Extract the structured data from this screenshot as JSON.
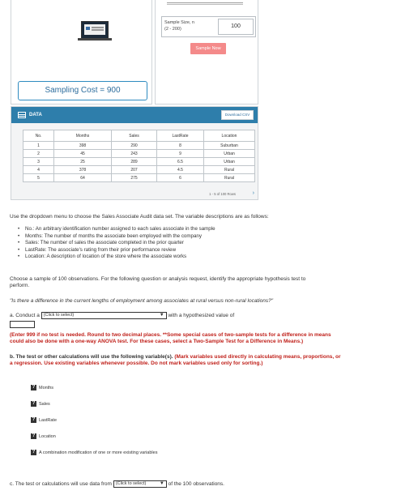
{
  "sampling_cost_label": "Sampling Cost = 900",
  "sample_size": {
    "label_line1": "Sample Size, n",
    "label_line2": "(2 - 200)",
    "value": "100",
    "button_label": "Sample Now"
  },
  "data_panel": {
    "title": "DATA",
    "download_label": "Download CSV",
    "columns": [
      "No.",
      "Months",
      "Sales",
      "LastRate",
      "Location"
    ],
    "rows": [
      [
        "1",
        "398",
        "290",
        "8",
        "Suburban"
      ],
      [
        "2",
        "45",
        "243",
        "9",
        "Urban"
      ],
      [
        "3",
        "25",
        "289",
        "6.5",
        "Urban"
      ],
      [
        "4",
        "378",
        "207",
        "4.5",
        "Rural"
      ],
      [
        "5",
        "64",
        "275",
        "6",
        "Rural"
      ]
    ],
    "pager_text": "1 - 5 of 100 Rows",
    "pager_next": "›"
  },
  "instructions": {
    "intro": "Use the dropdown menu to choose the Sales Associate Audit data set. The variable descriptions are as follows:",
    "variables": [
      "No.: An arbitrary identification number assigned to each sales associate in the sample",
      "Months: The number of months the associate been employed with the company",
      "Sales: The number of sales the associate completed in the prior quarter",
      "LastRate: The associate's rating from their prior performance review",
      "Location: A description of location of the store where the associate works"
    ],
    "choose_line1": "Choose a sample of 100 observations. For the following question or analysis request, identify the appropriate hypothesis test to",
    "choose_line2": "perform.",
    "question": "\"Is there a difference in the current lengths of employment among associates at rural versus non-rural locations?\""
  },
  "part_a": {
    "prefix": "a. Conduct a",
    "select_label": "(Click to select)",
    "suffix": "with a hypothesized value of",
    "note_line1": "(Enter 999 if no test is needed. Round to two decimal places. **Some special cases of two-sample tests for a difference in means",
    "note_line2": "could also be done with a one-way ANOVA test. For these cases, select a Two-Sample Test for a Difference in Means.)"
  },
  "part_b": {
    "text_plain": "b. The test or other calculations will use the following variable(s).",
    "text_red_1": "(Mark variables used directly in calculating means, proportions, or",
    "text_red_2": "a regression. Use existing variables whenever possible. Do not mark variables used only for sorting.)",
    "options": [
      "Months",
      "Sales",
      "LastRate",
      "Location",
      "A combination modification of one or more existing variables"
    ],
    "checkbox_mark": "?"
  },
  "part_c": {
    "prefix": "c. The test or calculations will use data from",
    "select_label": "(Click to select)",
    "suffix": "of the 100 observations."
  },
  "colors": {
    "header_blue": "#2e7eab",
    "sample_button": "#f48a8a",
    "note_red": "#c0211b"
  }
}
